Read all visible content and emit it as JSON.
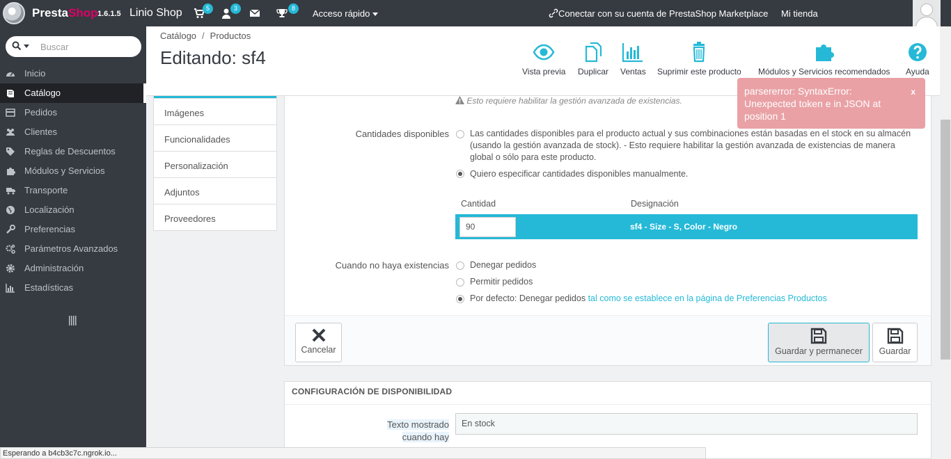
{
  "header": {
    "brand_main": "Presta",
    "brand_accent": "Shop",
    "version": "1.6.1.5",
    "shop_name": "Linio Shop",
    "badges": {
      "orders": "5",
      "customers": "3",
      "trophies": "8"
    },
    "quick_access": "Acceso rápido",
    "marketplace": "Conectar con su cuenta de PrestaShop Marketplace",
    "my_shop": "Mi tienda"
  },
  "sidebar": {
    "search_placeholder": "Buscar",
    "items": [
      {
        "label": "Inicio",
        "icon": "dashboard-icon"
      },
      {
        "label": "Catálogo",
        "icon": "book-icon"
      },
      {
        "label": "Pedidos",
        "icon": "credit-card-icon"
      },
      {
        "label": "Clientes",
        "icon": "users-icon"
      },
      {
        "label": "Reglas de Descuentos",
        "icon": "tag-icon"
      },
      {
        "label": "Módulos y Servicios",
        "icon": "puzzle-icon"
      },
      {
        "label": "Transporte",
        "icon": "truck-icon"
      },
      {
        "label": "Localización",
        "icon": "globe-icon"
      },
      {
        "label": "Preferencias",
        "icon": "wrench-icon"
      },
      {
        "label": "Parámetros Avanzados",
        "icon": "cogs-icon"
      },
      {
        "label": "Administración",
        "icon": "gear-icon"
      },
      {
        "label": "Estadísticas",
        "icon": "bar-chart-icon"
      }
    ]
  },
  "pagehead": {
    "breadcrumb": [
      "Catálogo",
      "Productos"
    ],
    "title": "Editando: sf4",
    "toolbar": {
      "preview": "Vista previa",
      "duplicate": "Duplicar",
      "sales": "Ventas",
      "delete": "Suprimir este producto",
      "modules": "Módulos y Servicios recomendados",
      "help": "Ayuda"
    }
  },
  "tabs": [
    "Imágenes",
    "Funcionalidades",
    "Personalización",
    "Adjuntos",
    "Proveedores"
  ],
  "form": {
    "warning": "Esto requiere habilitar la gestión avanzada de existencias.",
    "available_label": "Cantidades disponibles",
    "available_opt1_l1": "Las cantidades disponibles para el producto actual y sus combinaciones están basadas en el stock en su almacén",
    "available_opt1_l2": "(usando la gestión avanzada de stock).  - Esto requiere habilitar la gestión avanzada de existencias de manera",
    "available_opt1_l3": "global o sólo para este producto.",
    "available_opt2": "Quiero especificar cantidades disponibles manualmente.",
    "table": {
      "col_qty": "Cantidad",
      "col_designation": "Designación",
      "qty_value": "90",
      "designation": "sf4 - Size - S, Color - Negro"
    },
    "oos_label": "Cuando no haya existencias",
    "oos_opt1": "Denegar pedidos",
    "oos_opt2": "Permitir pedidos",
    "oos_opt3": "Por defecto: Denegar pedidos",
    "oos_opt3_link": "tal como se establece en la página de Preferencias Productos",
    "cancel": "Cancelar",
    "save_stay": "Guardar y permanecer",
    "save": "Guardar"
  },
  "availability": {
    "heading": "Configuración de disponibilidad",
    "label_l1": "Texto mostrado",
    "label_l2": "cuando hay",
    "value": "En stock"
  },
  "growl": {
    "message": "parsererror: SyntaxError: Unexpected token e in JSON at position 1",
    "close": "x"
  },
  "statusbar": "Esperando a b4cb3c7c.ngrok.io...",
  "colors": {
    "accent": "#25b9d7",
    "sidebar": "#363a41",
    "brand": "#df0067",
    "error": "#e9a1a5"
  }
}
